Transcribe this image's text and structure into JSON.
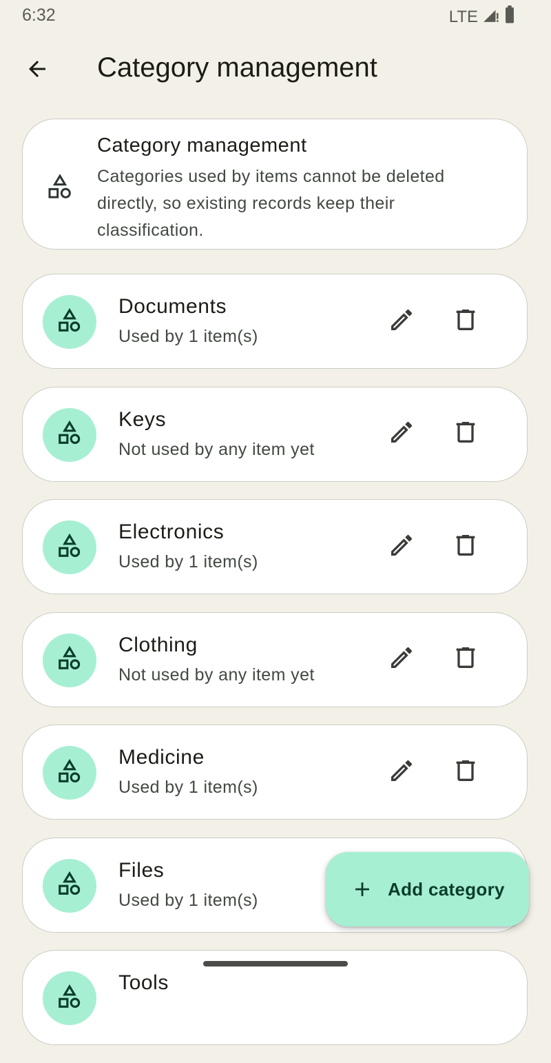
{
  "status_bar": {
    "time": "6:32",
    "network": "LTE",
    "icons": [
      "signal-icon",
      "battery-icon"
    ]
  },
  "app_bar": {
    "title": "Category management",
    "back_icon": "arrow-back-icon"
  },
  "info_card": {
    "title": "Category management",
    "description": "Categories used by items cannot be deleted directly, so existing records keep their classification.",
    "icon": "category-shapes-icon"
  },
  "categories": [
    {
      "name": "Documents",
      "usage": "Used by 1 item(s)"
    },
    {
      "name": "Keys",
      "usage": "Not used by any item yet"
    },
    {
      "name": "Electronics",
      "usage": "Used by 1 item(s)"
    },
    {
      "name": "Clothing",
      "usage": "Not used by any item yet"
    },
    {
      "name": "Medicine",
      "usage": "Used by 1 item(s)"
    },
    {
      "name": "Files",
      "usage": "Used by 1 item(s)"
    },
    {
      "name": "Tools",
      "usage": ""
    }
  ],
  "fab": {
    "label": "Add category",
    "icon": "plus-icon"
  },
  "colors": {
    "background": "#f3f1e7",
    "card": "#ffffff",
    "accent_container": "#a7efd3",
    "on_accent": "#0b3d2c"
  }
}
